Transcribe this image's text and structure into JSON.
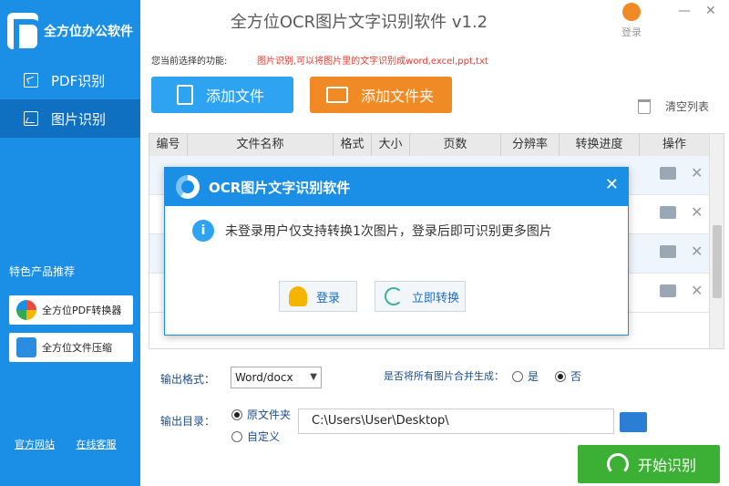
{
  "app": {
    "brand": "全方位办公软件",
    "title": "全方位OCR图片文字识别软件 v1.2",
    "login_label": "登录",
    "minimize": "—",
    "close": "✕"
  },
  "sidebar": {
    "items": [
      {
        "label": "PDF识别",
        "icon": "pdf-doc-icon"
      },
      {
        "label": "图片识别",
        "icon": "image-icon"
      }
    ],
    "featured_title": "特色产品推荐",
    "featured": [
      {
        "label": "全方位PDF转换器"
      },
      {
        "label": "全方位文件压缩"
      }
    ],
    "links": [
      "官方网站",
      "在线客服"
    ]
  },
  "function": {
    "label": "您当前选择的功能:",
    "desc": "图片识别,可以将图片里的文字识别成word,excel,ppt,txt"
  },
  "toolbar": {
    "add_file": "添加文件",
    "add_folder": "添加文件夹",
    "clear_list": "清空列表"
  },
  "table": {
    "columns": [
      "编号",
      "文件名称",
      "格式",
      "大小",
      "页数",
      "分辨率",
      "转换进度",
      "操作"
    ],
    "row_count": 4
  },
  "dialog": {
    "title": "OCR图片文字识别软件",
    "message": "未登录用户仅支持转换1次图片，登录后即可识别更多图片",
    "login_button": "登录",
    "convert_button": "立即转换",
    "close": "✕",
    "info_glyph": "i"
  },
  "options": {
    "format_label": "输出格式：",
    "format_value": "Word/docx",
    "merge_question": "是否将所有图片合并生成：",
    "merge_yes": "是",
    "merge_no": "否",
    "merge_selected": "否",
    "dir_label": "输出目录：",
    "dir_original": "原文件夹",
    "dir_custom": "自定义",
    "dir_selected": "原文件夹",
    "path": "C:\\Users\\User\\Desktop\\"
  },
  "start_button": "开始识别",
  "colors": {
    "sidebar": "#1b8fe6",
    "add_file": "#2ea3f2",
    "add_folder": "#f08a24",
    "start": "#3cb034",
    "func_desc": "#e63b2e"
  }
}
